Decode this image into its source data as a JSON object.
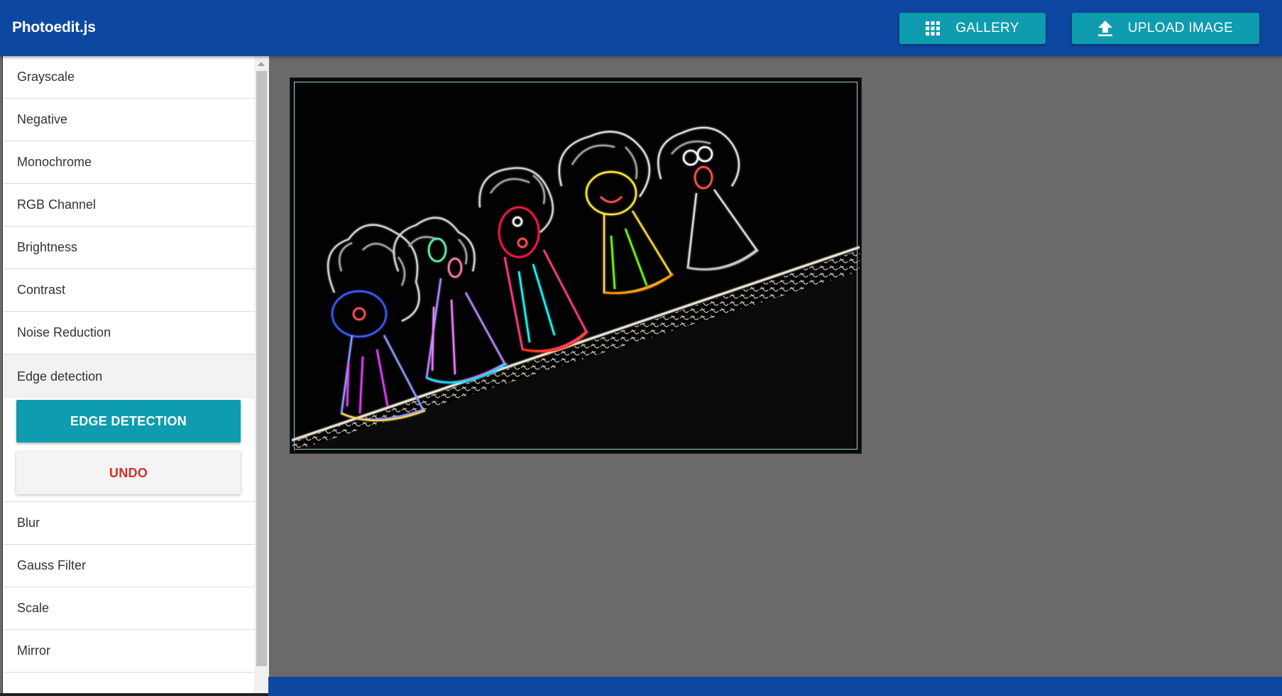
{
  "app": {
    "title": "Photoedit.js"
  },
  "toolbar": {
    "gallery_label": "GALLERY",
    "gallery_icon": "grid-icon",
    "upload_label": "UPLOAD IMAGE",
    "upload_icon": "upload-icon"
  },
  "sidebar": {
    "items_before": [
      {
        "label": "Grayscale"
      },
      {
        "label": "Negative"
      },
      {
        "label": "Monochrome"
      },
      {
        "label": "RGB Channel"
      },
      {
        "label": "Brightness"
      },
      {
        "label": "Contrast"
      },
      {
        "label": "Noise Reduction"
      }
    ],
    "active": {
      "label": "Edge detection",
      "apply_label": "EDGE DETECTION",
      "undo_label": "UNDO"
    },
    "items_after": [
      {
        "label": "Blur"
      },
      {
        "label": "Gauss Filter"
      },
      {
        "label": "Scale"
      },
      {
        "label": "Mirror"
      }
    ]
  },
  "colors": {
    "primary": "#0d47a1",
    "accent": "#0e9cae",
    "undo_text": "#d32f2f",
    "workspace": "#6a6a6a"
  }
}
